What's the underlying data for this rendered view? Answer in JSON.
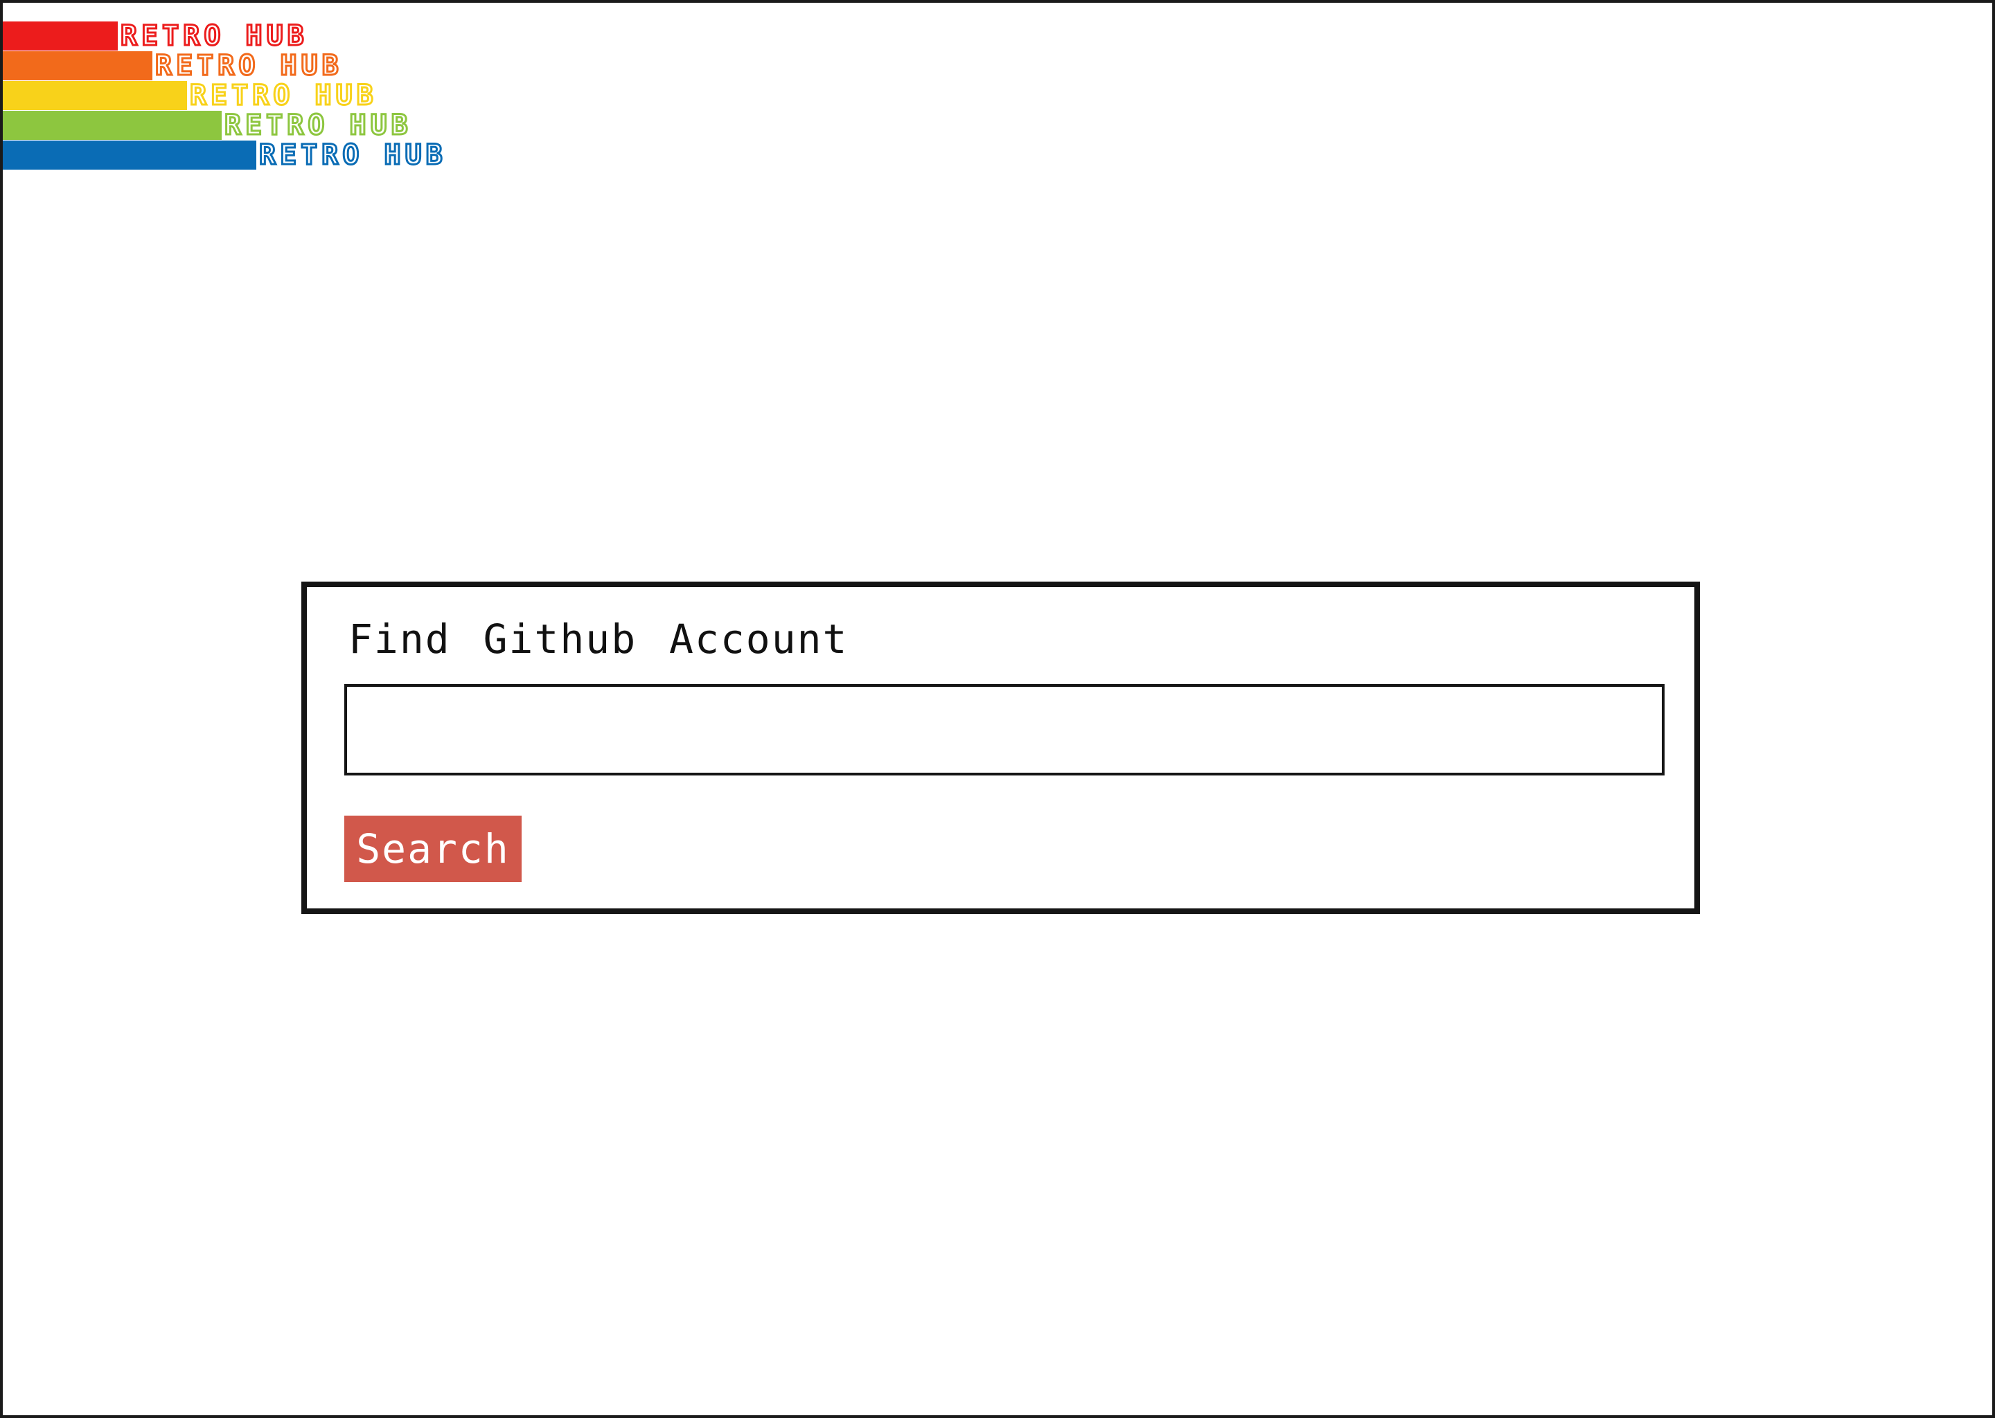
{
  "logo": {
    "text": "RETRO HUB",
    "stripe_colors": [
      "#ec1c1c",
      "#f26a1b",
      "#f8d21a",
      "#8dc63f",
      "#0a6cb5"
    ]
  },
  "search_card": {
    "title": "Find Github Account",
    "input_value": "",
    "input_placeholder": "",
    "button_label": "Search",
    "button_color": "#d1584b"
  }
}
